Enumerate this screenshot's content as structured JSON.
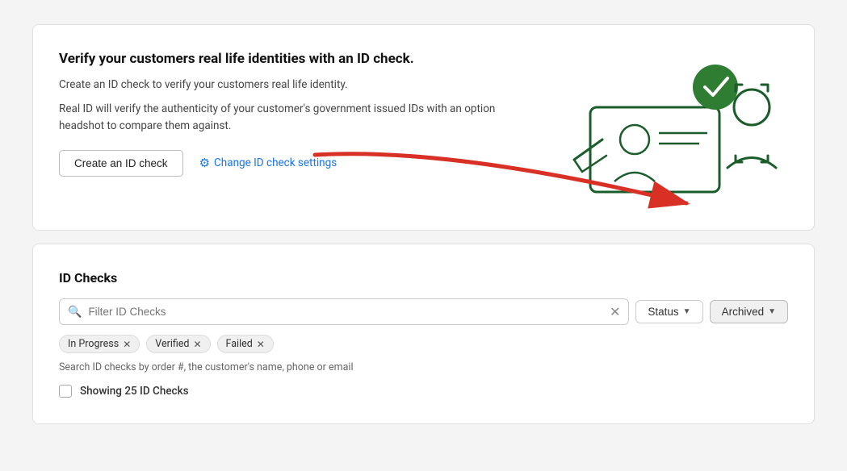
{
  "hero": {
    "title": "Verify your customers real life identities with an ID check.",
    "desc1": "Create an ID check to verify your customers real life identity.",
    "desc2": "Real ID will verify the authenticity of your customer's government issued IDs with an option headshot to compare them against.",
    "create_button": "Create an ID check",
    "settings_link": "Change ID check settings"
  },
  "id_checks": {
    "section_title": "ID Checks",
    "search_placeholder": "Filter ID Checks",
    "status_button": "Status",
    "archived_button": "Archived",
    "tags": [
      {
        "label": "In Progress"
      },
      {
        "label": "Verified"
      },
      {
        "label": "Failed"
      }
    ],
    "search_hint": "Search ID checks by order #, the customer's name, phone or email",
    "showing_label": "Showing 25 ID Checks"
  }
}
